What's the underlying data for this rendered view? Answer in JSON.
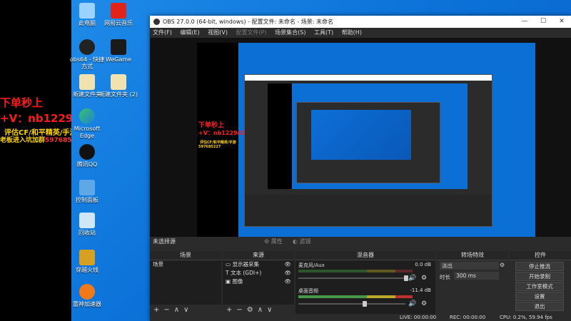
{
  "overlay": {
    "line1": "下单秒上",
    "line2": "+V：nb122943",
    "line3": "评估CF/和平精英/手游",
    "line4_prefix": "老板进入坑加群",
    "line4_number": "597685227"
  },
  "desktop_icons": [
    {
      "label": "此电脑",
      "icon": "computer-icon"
    },
    {
      "label": "网易云音乐",
      "icon": "netease-music-icon"
    },
    {
      "label": "obs64 - 快捷方式",
      "icon": "obs-icon"
    },
    {
      "label": "WeGame",
      "icon": "wegame-icon"
    },
    {
      "label": "新建文件夹",
      "icon": "folder-icon"
    },
    {
      "label": "新建文件夹 (2)",
      "icon": "folder-icon"
    },
    {
      "label": "Microsoft Edge",
      "icon": "edge-icon"
    },
    {
      "label": "腾讯QQ",
      "icon": "qq-icon"
    },
    {
      "label": "控制面板",
      "icon": "control-panel-icon"
    },
    {
      "label": "回收站",
      "icon": "recycle-bin-icon"
    },
    {
      "label": "穿越火线",
      "icon": "crossfire-icon"
    },
    {
      "label": "雷神加速器",
      "icon": "leishen-icon"
    }
  ],
  "obs": {
    "title": "OBS 27.0.0 (64-bit, windows) - 配置文件: 未命名 - 场景: 未命名",
    "window_buttons": [
      "—",
      "☐",
      "✕"
    ],
    "menu": [
      "文件(F)",
      "编辑(E)",
      "视图(V)",
      "配置文件(P)",
      "场景集合(S)",
      "工具(T)",
      "帮助(H)"
    ],
    "menu_disabled_index": 3,
    "no_source_selected": "未选择源",
    "properties_label": "属性",
    "filters_label": "滤镜",
    "docks": {
      "scenes": {
        "header": "场景",
        "items": [
          "场景"
        ]
      },
      "sources": {
        "header": "来源",
        "items": [
          "显示器采集",
          "文本 (GDI+)",
          "图像"
        ]
      },
      "mixer": {
        "header": "混音器",
        "channels": [
          {
            "name": "麦克风/Aux",
            "db": "0.0 dB",
            "level": 0.0
          },
          {
            "name": "桌面音频",
            "db": "-11.4 dB",
            "level": 0.55
          }
        ]
      },
      "transitions": {
        "header": "转场特效",
        "type": "淡出",
        "duration_label": "时长",
        "duration_value": "300 ms"
      },
      "controls": {
        "header": "控件",
        "buttons": [
          "停止推流",
          "开始录制",
          "工作室模式",
          "设置",
          "退出"
        ]
      }
    },
    "status": {
      "live": "LIVE: 00:00:00",
      "rec": "REC: 00:00:00",
      "cpu": "CPU: 0.2%, 59.94 fps"
    }
  }
}
